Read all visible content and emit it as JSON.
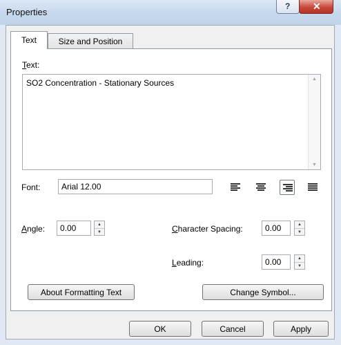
{
  "window": {
    "title": "Properties"
  },
  "tabs": [
    {
      "label": "Text"
    },
    {
      "label": "Size and Position"
    }
  ],
  "text_section": {
    "label": "Text:",
    "value": "SO2 Concentration - Stationary Sources"
  },
  "font": {
    "label": "Font:",
    "value": "Arial 12.00"
  },
  "alignment": {
    "options": [
      "align-left",
      "align-center",
      "align-right",
      "justify"
    ],
    "selected": "align-right"
  },
  "angle": {
    "label": "Angle:",
    "value": "0.00"
  },
  "character_spacing": {
    "label": "Character Spacing:",
    "value": "0.00"
  },
  "leading": {
    "label": "Leading:",
    "value": "0.00"
  },
  "buttons": {
    "about_formatting": "About Formatting Text",
    "change_symbol": "Change Symbol...",
    "ok": "OK",
    "cancel": "Cancel",
    "apply": "Apply"
  }
}
